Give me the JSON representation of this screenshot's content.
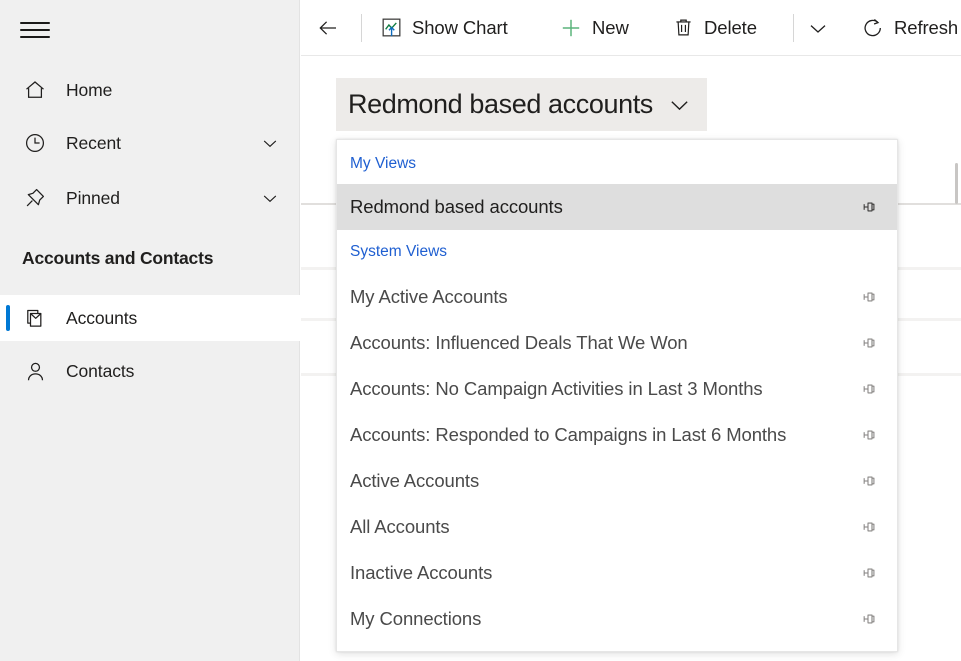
{
  "sidebar": {
    "menu_icon": "hamburger-icon",
    "nav": [
      {
        "label": "Home",
        "icon": "home-icon",
        "chevron": false
      },
      {
        "label": "Recent",
        "icon": "clock-icon",
        "chevron": true
      },
      {
        "label": "Pinned",
        "icon": "pin-icon",
        "chevron": true
      }
    ],
    "group_header": "Accounts and Contacts",
    "sub_items": [
      {
        "label": "Accounts",
        "icon": "accounts-icon",
        "selected": true
      },
      {
        "label": "Contacts",
        "icon": "person-icon",
        "selected": false
      }
    ]
  },
  "commandbar": {
    "back": {
      "label": "",
      "icon": "back-arrow-icon"
    },
    "items": [
      {
        "label": "Show Chart",
        "icon": "show-chart-icon"
      },
      {
        "label": "New",
        "icon": "plus-icon"
      },
      {
        "label": "Delete",
        "icon": "trash-icon"
      },
      {
        "label": "",
        "icon": "chevron-down-icon"
      },
      {
        "label": "Refresh",
        "icon": "refresh-icon"
      }
    ]
  },
  "view_selector": {
    "current_view": "Redmond based accounts",
    "chevron": "chevron-down-icon",
    "expanded": true
  },
  "flyout": {
    "groups": [
      {
        "header": "My Views",
        "items": [
          {
            "label": "Redmond based accounts",
            "highlighted": true,
            "pin": "pin-icon"
          }
        ]
      },
      {
        "header": "System Views",
        "items": [
          {
            "label": "My Active Accounts",
            "highlighted": false,
            "pin": "pin-icon"
          },
          {
            "label": "Accounts: Influenced Deals That We Won",
            "highlighted": false,
            "pin": "pin-icon"
          },
          {
            "label": "Accounts: No Campaign Activities in Last 3 Months",
            "highlighted": false,
            "pin": "pin-icon"
          },
          {
            "label": "Accounts: Responded to Campaigns in Last 6 Months",
            "highlighted": false,
            "pin": "pin-icon"
          },
          {
            "label": "Active Accounts",
            "highlighted": false,
            "pin": "pin-icon"
          },
          {
            "label": "All Accounts",
            "highlighted": false,
            "pin": "pin-icon"
          },
          {
            "label": "Inactive Accounts",
            "highlighted": false,
            "pin": "pin-icon"
          },
          {
            "label": "My Connections",
            "highlighted": false,
            "pin": "pin-icon"
          }
        ]
      }
    ]
  },
  "colors": {
    "accent": "#0078d4",
    "link": "#1f5fd1",
    "sidebar_bg": "#f0f0f0",
    "highlight_bg": "#dedede",
    "view_button_bg": "#edebe9",
    "chart_icon_green": "#107c41",
    "chart_icon_blue": "#0f6cbd"
  }
}
